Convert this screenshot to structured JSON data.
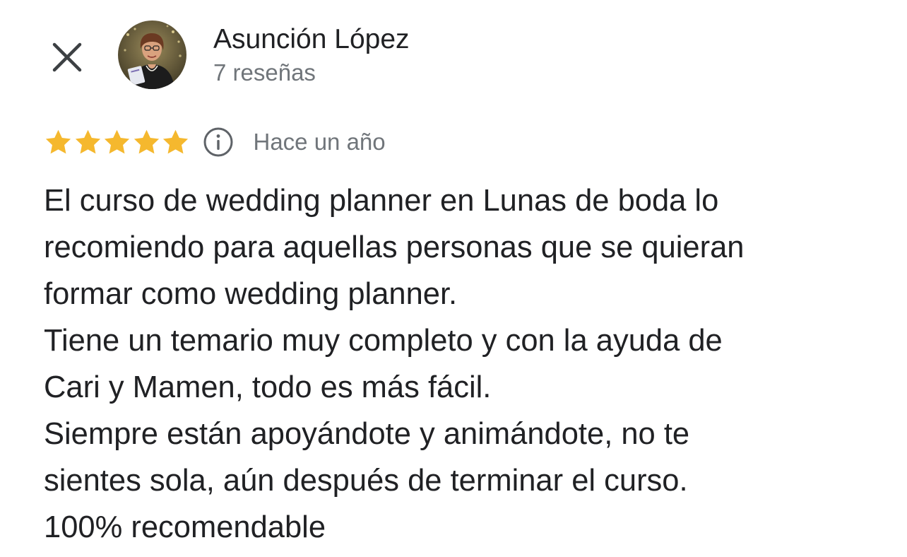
{
  "header": {
    "close_icon": "close-icon",
    "reviewer": {
      "name": "Asunción López",
      "review_count": "7 reseñas",
      "avatar_icon": "profile-photo"
    }
  },
  "review": {
    "rating": 5,
    "max_rating": 5,
    "star_color": "#f5b82e",
    "info_icon": "info-icon",
    "date": "Hace un año",
    "lines": [
      "El curso de wedding planner en Lunas de boda lo",
      "recomiendo para aquellas personas que se quieran",
      "formar como wedding planner.",
      "Tiene un temario muy completo y con la ayuda de",
      "Cari y Mamen, todo es más fácil.",
      "Siempre están apoyándote y animándote, no te",
      "sientes sola, aún después de terminar el curso.",
      "100% recomendable"
    ]
  }
}
